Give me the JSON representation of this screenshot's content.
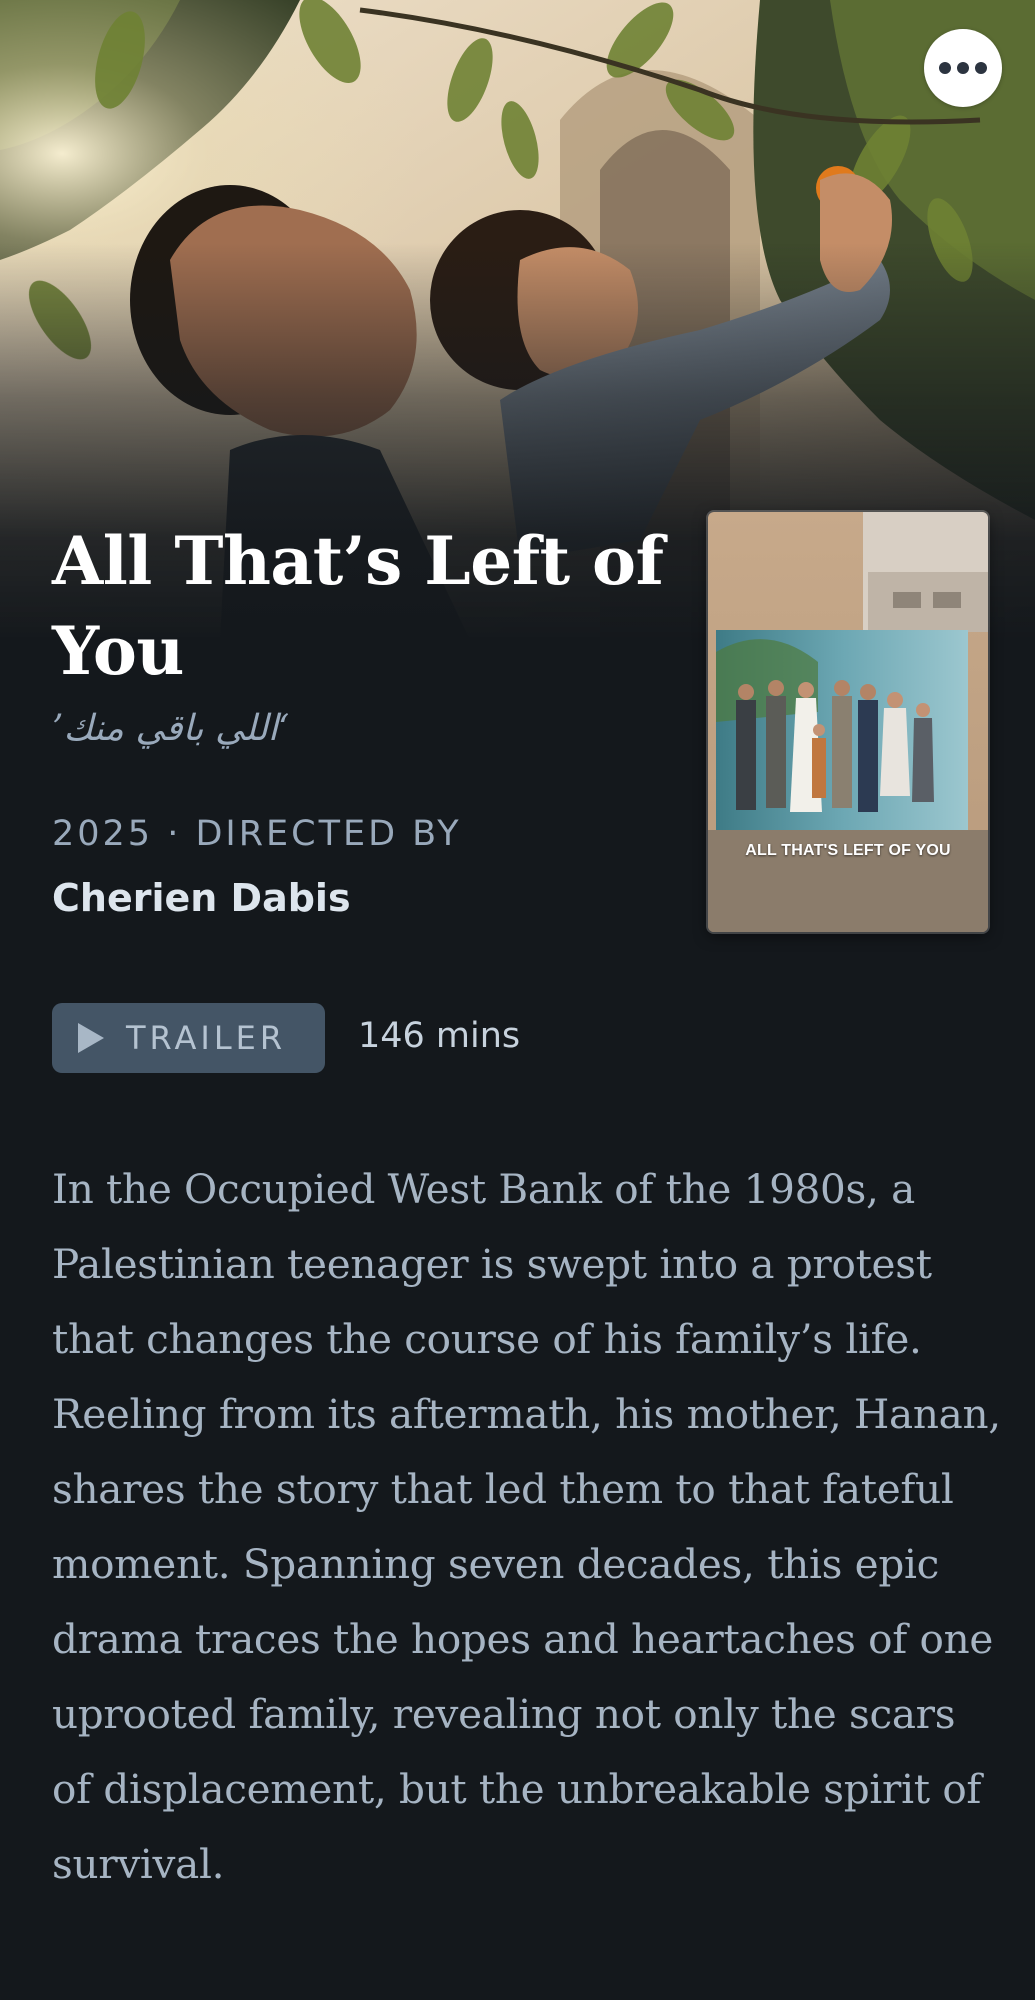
{
  "film": {
    "title": "All That’s Left of You",
    "original_title": "‘اللي باقي منك’",
    "meta_line": "2025 · DIRECTED BY",
    "director": "Cherien Dabis",
    "runtime": "146 mins",
    "synopsis": "In the Occupied West Bank of the 1980s, a Palestinian teenager is swept into a protest that changes the course of his family’s life. Reeling from its aftermath, his mother, Hanan, shares the story that led them to that fateful moment. Spanning seven decades, this epic drama traces the hopes and heartaches of one uprooted family, revealing not only the scars of displacement, but the unbreakable spirit of survival."
  },
  "actions": {
    "trailer_label": "TRAILER",
    "more_icon": "more-options-icon",
    "play_icon": "play-icon"
  },
  "poster": {
    "title_text": "ALL THAT'S LEFT OF YOU"
  },
  "colors": {
    "background": "#14181c",
    "trailer_button": "#445566",
    "muted_text": "#99a9bb",
    "synopsis_text": "#a6b4c3"
  }
}
